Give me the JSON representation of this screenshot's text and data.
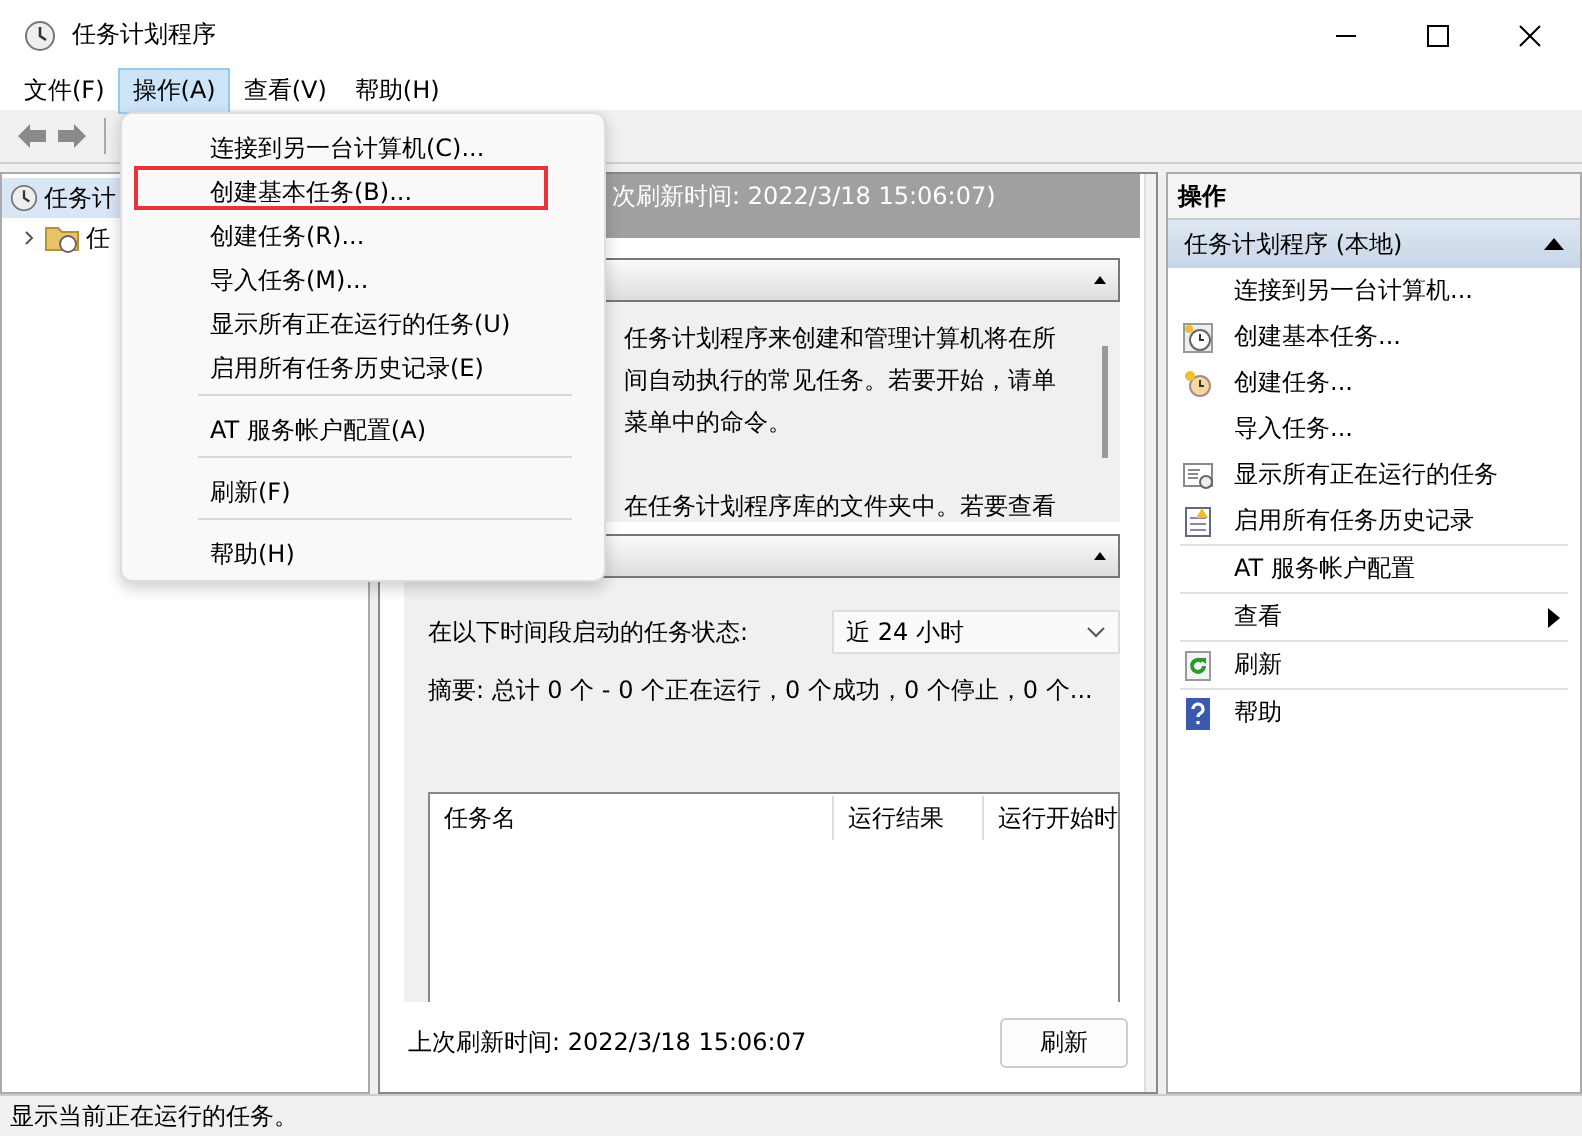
{
  "window": {
    "title": "任务计划程序"
  },
  "menubar": [
    {
      "label": "文件(F)",
      "selected": false
    },
    {
      "label": "操作(A)",
      "selected": true
    },
    {
      "label": "查看(V)",
      "selected": false
    },
    {
      "label": "帮助(H)",
      "selected": false
    }
  ],
  "tree": [
    {
      "label": "任务计",
      "kind": "clock",
      "selected": true
    },
    {
      "label": "任",
      "kind": "folder",
      "selected": false,
      "expanded": false
    }
  ],
  "center": {
    "header": "次刷新时间: 2022/3/18 15:06:07)",
    "overview_paragraphs": [
      [
        "任务计划程序来创建和管理计算机将在所",
        "间自动执行的常见任务。若要开始，请单",
        "菜单中的命令。"
      ],
      [
        "在任务计划程序库的文件夹中。若要查看"
      ]
    ],
    "status_label": "在以下时间段启动的任务状态:",
    "period": "近 24 小时",
    "summary": "摘要: 总计 0 个 - 0 个正在运行，0 个成功，0 个停止，0 个...",
    "columns": [
      "任务名",
      "运行结果",
      "运行开始时"
    ],
    "last_refresh": "上次刷新时间: 2022/3/18 15:06:07",
    "refresh_button": "刷新"
  },
  "actions": {
    "title": "操作",
    "section": "任务计划程序 (本地)",
    "items": [
      {
        "kind": "plain",
        "label": "连接到另一台计算机..."
      },
      {
        "kind": "clock",
        "label": "创建基本任务..."
      },
      {
        "kind": "timer",
        "label": "创建任务..."
      },
      {
        "kind": "plain",
        "label": "导入任务..."
      },
      {
        "kind": "list",
        "label": "显示所有正在运行的任务"
      },
      {
        "kind": "log",
        "label": "启用所有任务历史记录"
      },
      {
        "kind": "separator"
      },
      {
        "kind": "plain",
        "label": "AT 服务帐户配置"
      },
      {
        "kind": "separator"
      },
      {
        "kind": "plain",
        "label": "查看",
        "submenu": true
      },
      {
        "kind": "separator"
      },
      {
        "kind": "refresh",
        "label": "刷新"
      },
      {
        "kind": "separator"
      },
      {
        "kind": "help",
        "label": "帮助"
      }
    ]
  },
  "menu": [
    {
      "kind": "item",
      "label": "连接到另一台计算机(C)...",
      "outlined": false
    },
    {
      "kind": "item",
      "label": "创建基本任务(B)...",
      "outlined": true
    },
    {
      "kind": "item",
      "label": "创建任务(R)...",
      "outlined": false
    },
    {
      "kind": "item",
      "label": "导入任务(M)...",
      "outlined": false
    },
    {
      "kind": "item",
      "label": "显示所有正在运行的任务(U)",
      "outlined": false
    },
    {
      "kind": "item",
      "label": "启用所有任务历史记录(E)",
      "outlined": false
    },
    {
      "kind": "separator"
    },
    {
      "kind": "item",
      "label": "AT 服务帐户配置(A)",
      "outlined": false
    },
    {
      "kind": "separator"
    },
    {
      "kind": "item",
      "label": "刷新(F)",
      "outlined": false
    },
    {
      "kind": "separator"
    },
    {
      "kind": "item",
      "label": "帮助(H)",
      "outlined": false
    }
  ],
  "status_bar": "显示当前正在运行的任务。"
}
